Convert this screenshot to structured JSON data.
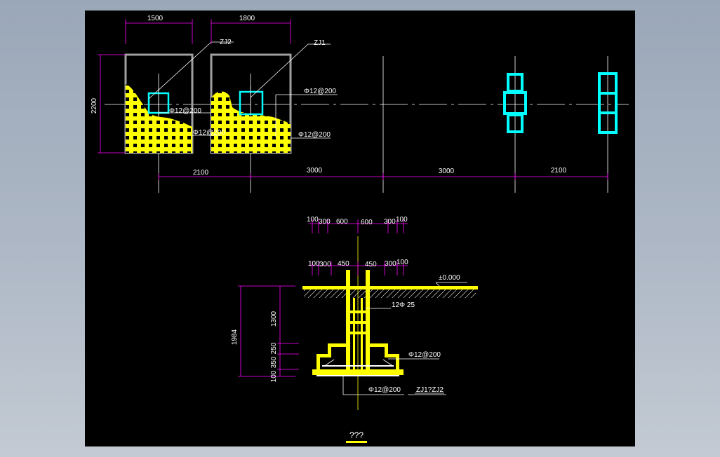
{
  "colors": {
    "background_outer": "#a9b4c2",
    "canvas": "#000000",
    "dimension_line": "#ff00ff",
    "concrete": "#ffff00",
    "column": "#00ffff",
    "outline": "#a0a0a0",
    "text": "#ffffff",
    "axis": "#ffffff"
  },
  "plan": {
    "dims_top": [
      "1500",
      "1800"
    ],
    "dim_left": "2200",
    "dims_bottom": [
      "2100",
      "3000",
      "3000",
      "2100"
    ],
    "footing_labels": [
      "ZJ2",
      "ZJ1"
    ],
    "rebar_labels": [
      "Φ12@200",
      "Φ12@200",
      "Φ12@200",
      "Φ12@200"
    ]
  },
  "section": {
    "dims_top_row1": [
      "100",
      "300",
      "600",
      "600",
      "300",
      "100"
    ],
    "dims_top_row2": [
      "100",
      "300",
      "450",
      "450",
      "300",
      "100"
    ],
    "dim_left_total": "1984",
    "dims_left": [
      "1300",
      "250",
      "350",
      "100"
    ],
    "level_label": "±0.000",
    "rebar_vertical": "12Φ  25",
    "rebar_side": "Φ12@200",
    "rebar_bottom": "Φ12@200",
    "footing_id": "ZJ1?ZJ2",
    "title": "???"
  }
}
